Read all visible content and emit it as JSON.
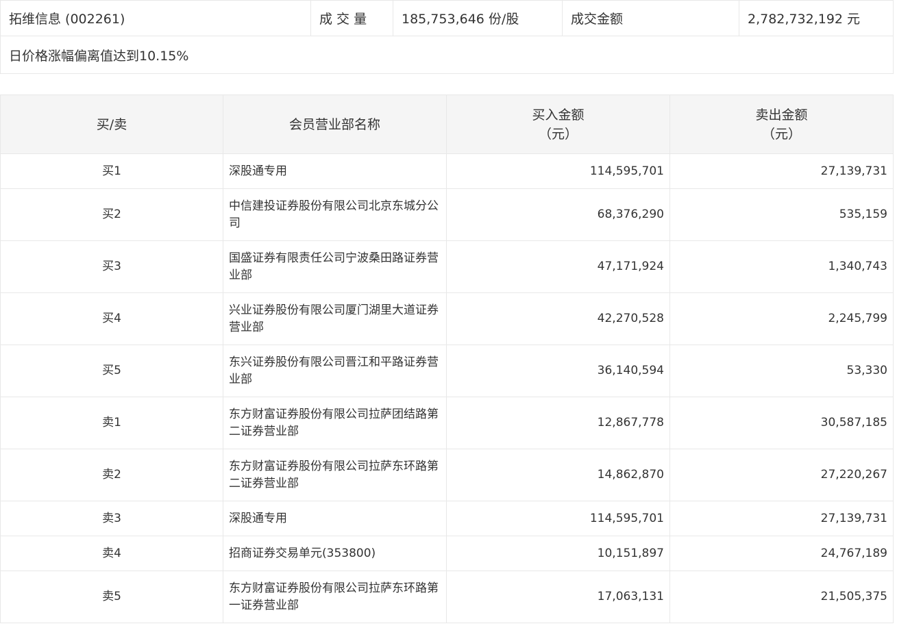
{
  "summary": {
    "stock": "拓维信息 (002261)",
    "volume_label": "成 交 量",
    "volume_value": "185,753,646 份/股",
    "amount_label": "成交金额",
    "amount_value": "2,782,732,192 元",
    "reason": "日价格涨幅偏离值达到10.15%"
  },
  "table": {
    "headers": {
      "side": "买/卖",
      "name": "会员营业部名称",
      "buy_line1": "买入金额",
      "buy_line2": "（元）",
      "sell_line1": "卖出金额",
      "sell_line2": "（元）"
    },
    "rows": [
      {
        "side": "买1",
        "name": "深股通专用",
        "buy": "114,595,701",
        "sell": "27,139,731"
      },
      {
        "side": "买2",
        "name": "中信建投证券股份有限公司北京东城分公司",
        "buy": "68,376,290",
        "sell": "535,159"
      },
      {
        "side": "买3",
        "name": "国盛证券有限责任公司宁波桑田路证券营业部",
        "buy": "47,171,924",
        "sell": "1,340,743"
      },
      {
        "side": "买4",
        "name": "兴业证券股份有限公司厦门湖里大道证券营业部",
        "buy": "42,270,528",
        "sell": "2,245,799"
      },
      {
        "side": "买5",
        "name": "东兴证券股份有限公司晋江和平路证券营业部",
        "buy": "36,140,594",
        "sell": "53,330"
      },
      {
        "side": "卖1",
        "name": "东方财富证券股份有限公司拉萨团结路第二证券营业部",
        "buy": "12,867,778",
        "sell": "30,587,185"
      },
      {
        "side": "卖2",
        "name": "东方财富证券股份有限公司拉萨东环路第二证券营业部",
        "buy": "14,862,870",
        "sell": "27,220,267"
      },
      {
        "side": "卖3",
        "name": "深股通专用",
        "buy": "114,595,701",
        "sell": "27,139,731"
      },
      {
        "side": "卖4",
        "name": "招商证券交易单元(353800)",
        "buy": "10,151,897",
        "sell": "24,767,189"
      },
      {
        "side": "卖5",
        "name": "东方财富证券股份有限公司拉萨东环路第一证券营业部",
        "buy": "17,063,131",
        "sell": "21,505,375"
      }
    ]
  }
}
